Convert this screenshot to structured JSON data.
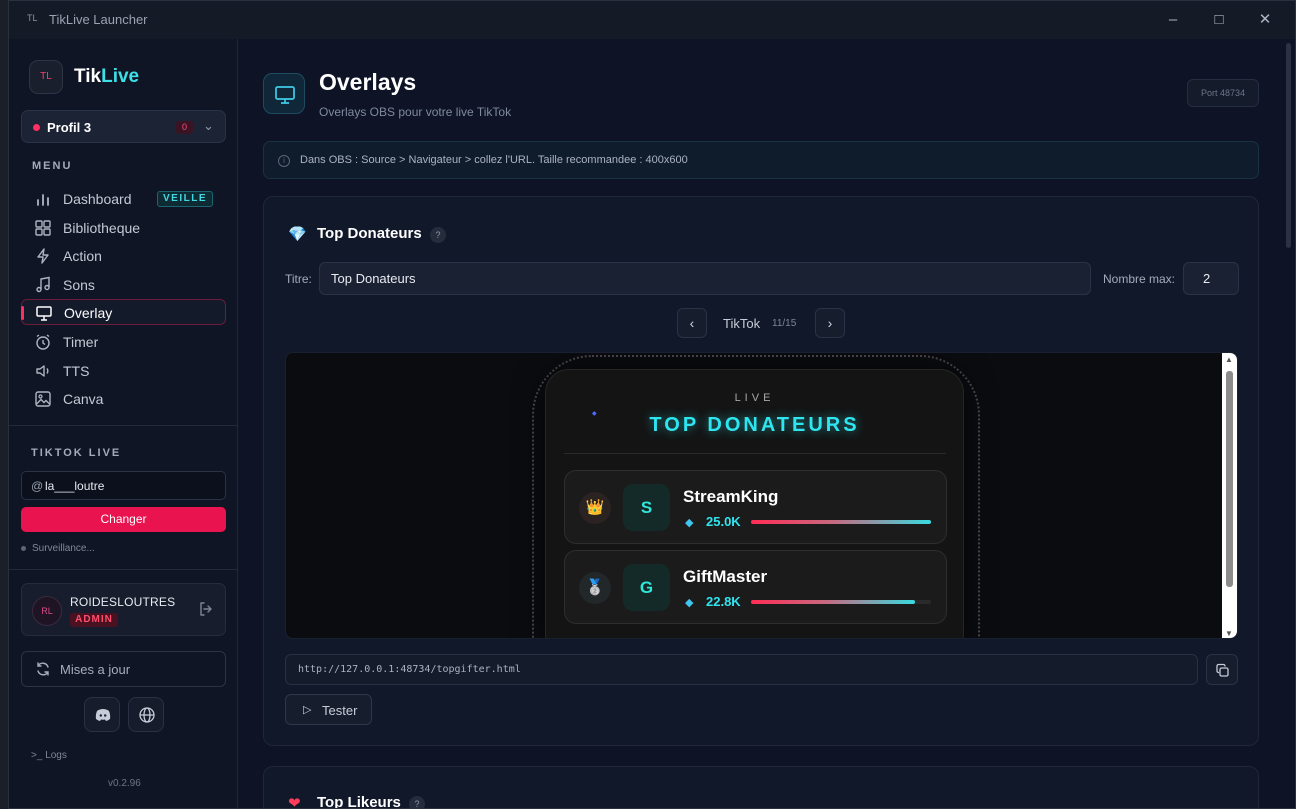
{
  "window": {
    "title": "TikLive Launcher",
    "app_icon": "TL"
  },
  "sidebar": {
    "logo_mark": "TL",
    "logo_main": "Tik",
    "logo_accent": "Live",
    "profile": {
      "name": "Profil 3",
      "count": "0"
    },
    "menu_heading": "MENU",
    "items": [
      {
        "label": "Dashboard",
        "icon": "bar-chart-icon",
        "badge": "VEILLE"
      },
      {
        "label": "Bibliotheque",
        "icon": "grid-icon"
      },
      {
        "label": "Action",
        "icon": "lightning-icon"
      },
      {
        "label": "Sons",
        "icon": "music-icon"
      },
      {
        "label": "Overlay",
        "icon": "monitor-icon",
        "active": true
      },
      {
        "label": "Timer",
        "icon": "alarm-icon"
      },
      {
        "label": "TTS",
        "icon": "speaker-icon"
      },
      {
        "label": "Canva",
        "icon": "image-icon"
      }
    ],
    "tiktok_heading": "TIKTOK LIVE",
    "username_prefix": "@",
    "username": "la___loutre",
    "change_button": "Changer",
    "status": "Surveillance...",
    "user": {
      "name": "ROIDESLOUTRES",
      "role": "ADMIN"
    },
    "updates_button": "Mises a jour",
    "logs": "Logs",
    "version": "v0.2.96"
  },
  "main": {
    "title": "Overlays",
    "subtitle": "Overlays OBS pour votre live TikTok",
    "port": "Port 48734",
    "info": "Dans OBS : Source > Navigateur > collez l'URL. Taille recommandee : 400x600",
    "card": {
      "icon_glyph": "💎",
      "title": "Top Donateurs",
      "help": "?",
      "titre_label": "Titre:",
      "titre_value": "Top Donateurs",
      "max_label": "Nombre max:",
      "max_value": "2",
      "theme_name": "TikTok",
      "theme_index": "11/15",
      "preview": {
        "live": "LIVE",
        "heading": "TOP DONATEURS",
        "gifters": [
          {
            "initial": "S",
            "name": "StreamKing",
            "value": "25.0K",
            "rank_icon": "👑",
            "progress": 1.0
          },
          {
            "initial": "G",
            "name": "GiftMaster",
            "value": "22.8K",
            "rank_icon": "🥈",
            "progress": 0.91
          }
        ]
      },
      "url": "http://127.0.0.1:48734/topgifter.html",
      "test_button": "Tester"
    },
    "card2": {
      "icon_glyph": "❤",
      "title": "Top Likeurs",
      "help": "?"
    }
  }
}
